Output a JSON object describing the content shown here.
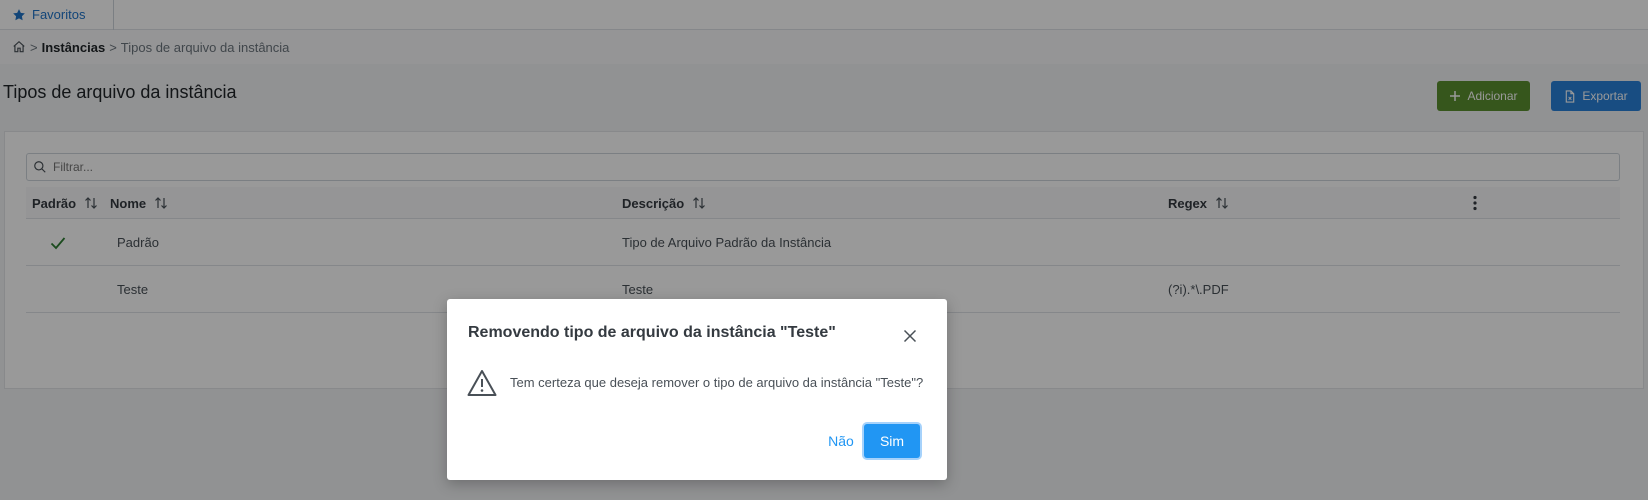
{
  "topbar": {
    "favorites_label": "Favoritos"
  },
  "breadcrumb": {
    "sep1": ">",
    "instances": "Instâncias",
    "sep2": ">",
    "current": "Tipos de arquivo da instância"
  },
  "page": {
    "title": "Tipos de arquivo da instância"
  },
  "toolbar": {
    "add_label": "Adicionar",
    "export_label": "Exportar"
  },
  "filter": {
    "placeholder": "Filtrar..."
  },
  "table": {
    "columns": {
      "default": "Padrão",
      "name": "Nome",
      "description": "Descrição",
      "regex": "Regex"
    },
    "rows": [
      {
        "default": true,
        "name": "Padrão",
        "description": "Tipo de Arquivo Padrão da Instância",
        "regex": ""
      },
      {
        "default": false,
        "name": "Teste",
        "description": "Teste",
        "regex": "(?i).*\\.PDF"
      }
    ]
  },
  "modal": {
    "title": "Removendo tipo de arquivo da instância \"Teste\"",
    "message": "Tem certeza que deseja remover o tipo de arquivo da instância \"Teste\"?",
    "no_label": "Não",
    "yes_label": "Sim"
  },
  "colors": {
    "add": "#5a8f2f",
    "export": "#2980d9",
    "primary": "#2196f3",
    "check": "#2e7d32"
  },
  "icons": [
    "star-icon",
    "home-icon",
    "plus-icon",
    "file-export-icon",
    "search-icon",
    "sort-icon",
    "kebab-menu-icon",
    "check-icon",
    "close-icon",
    "warning-icon"
  ]
}
